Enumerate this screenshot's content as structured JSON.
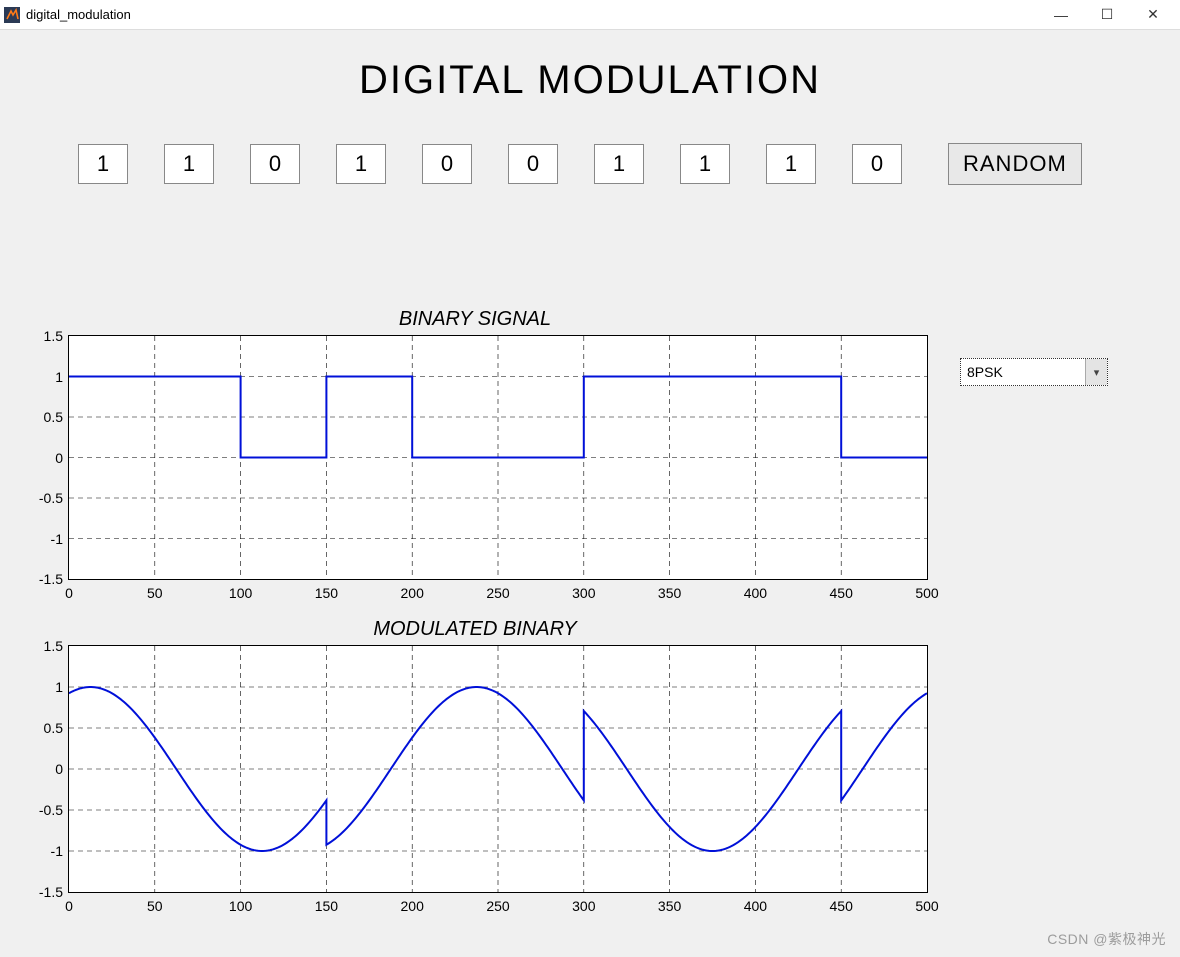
{
  "window": {
    "title": "digital_modulation",
    "controls": {
      "min": "—",
      "max": "☐",
      "close": "✕"
    }
  },
  "heading": "DIGITAL MODULATION",
  "bits": [
    "1",
    "1",
    "0",
    "1",
    "0",
    "0",
    "1",
    "1",
    "1",
    "0"
  ],
  "random_button": "RANDOM",
  "dropdown": {
    "selected": "8PSK"
  },
  "chart1_title": "BINARY SIGNAL",
  "chart2_title": "MODULATED BINARY",
  "watermark": "CSDN @紫极神光",
  "chart_data": [
    {
      "type": "line",
      "title": "BINARY SIGNAL",
      "xlabel": "",
      "ylabel": "",
      "xlim": [
        0,
        500
      ],
      "ylim": [
        -1.5,
        1.5
      ],
      "xticks": [
        0,
        50,
        100,
        150,
        200,
        250,
        300,
        350,
        400,
        450,
        500
      ],
      "yticks": [
        -1.5,
        -1,
        -0.5,
        0,
        0.5,
        1,
        1.5
      ],
      "series": [
        {
          "name": "binary",
          "x": [
            0,
            50,
            100,
            100,
            150,
            150,
            200,
            200,
            250,
            300,
            300,
            350,
            400,
            450,
            450,
            500
          ],
          "y": [
            1,
            1,
            1,
            0,
            0,
            1,
            1,
            0,
            0,
            0,
            1,
            1,
            1,
            1,
            0,
            0
          ]
        }
      ]
    },
    {
      "type": "line",
      "title": "MODULATED BINARY",
      "xlabel": "",
      "ylabel": "",
      "xlim": [
        0,
        500
      ],
      "ylim": [
        -1.5,
        1.5
      ],
      "xticks": [
        0,
        50,
        100,
        150,
        200,
        250,
        300,
        350,
        400,
        450,
        500
      ],
      "yticks": [
        -1.5,
        -1,
        -0.5,
        0,
        0.5,
        1,
        1.5
      ],
      "series": [
        {
          "name": "modulated",
          "segments": [
            {
              "phase_deg": 67.5,
              "x_start": 0,
              "x_end": 150
            },
            {
              "phase_deg": 22.5,
              "x_start": 150,
              "x_end": 300
            },
            {
              "phase_deg": 315,
              "x_start": 300,
              "x_end": 450
            },
            {
              "phase_deg": 247.5,
              "x_start": 450,
              "x_end": 500
            }
          ],
          "amplitude": 1.0,
          "carrier_period_samples": 200
        }
      ]
    }
  ]
}
